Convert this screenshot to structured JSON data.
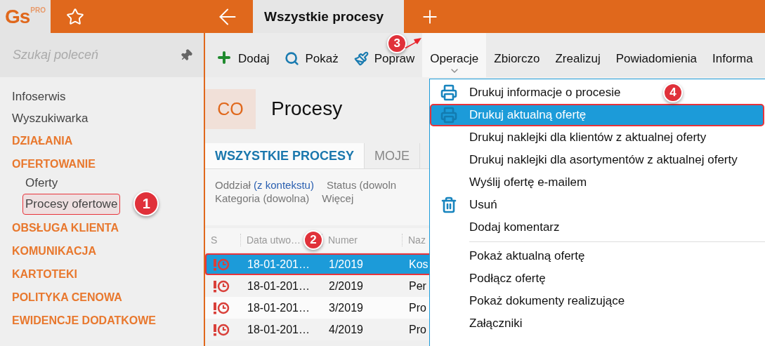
{
  "logo": {
    "text": "Gs",
    "badge": "PRO"
  },
  "tab": {
    "label": "Wszystkie procesy"
  },
  "sidebar": {
    "search": {
      "placeholder": "Szukaj poleceń"
    },
    "items": [
      {
        "kind": "link",
        "label": "Infoserwis"
      },
      {
        "kind": "link",
        "label": "Wyszukiwarka"
      },
      {
        "kind": "category",
        "label": "DZIAŁANIA"
      },
      {
        "kind": "category",
        "label": "OFERTOWANIE",
        "children": [
          {
            "label": "Oferty",
            "selected": false
          },
          {
            "label": "Procesy ofertowe",
            "selected": true,
            "badge": "1"
          }
        ]
      },
      {
        "kind": "category",
        "label": "OBSŁUGA KLIENTA"
      },
      {
        "kind": "category",
        "label": "KOMUNIKACJA"
      },
      {
        "kind": "category",
        "label": "KARTOTEKI"
      },
      {
        "kind": "category",
        "label": "POLITYKA CENOWA"
      },
      {
        "kind": "category",
        "label": "EWIDENCJE DODATKOWE"
      }
    ]
  },
  "toolbar": [
    {
      "kind": "add",
      "label": "Dodaj",
      "open": false
    },
    {
      "kind": "show",
      "label": "Pokaż",
      "open": false
    },
    {
      "kind": "edit",
      "label": "Popraw",
      "open": false,
      "badge": "3"
    },
    {
      "kind": "menu",
      "label": "Operacje",
      "open": true
    },
    {
      "kind": "menu",
      "label": "Zbiorczo",
      "open": false
    },
    {
      "kind": "menu",
      "label": "Zrealizuj",
      "open": false
    },
    {
      "kind": "menu",
      "label": "Powiadomienia",
      "open": false
    },
    {
      "kind": "menu",
      "label": "Informa",
      "open": false
    }
  ],
  "header": {
    "code": "CO",
    "title": "Procesy"
  },
  "view_tabs": [
    {
      "label": "WSZYSTKIE PROCESY",
      "selected": true
    },
    {
      "label": "MOJE",
      "selected": false
    }
  ],
  "filters": [
    [
      {
        "label": "Oddział",
        "value": "(z kontekstu)"
      },
      {
        "label": "Status (dowoln"
      }
    ],
    [
      {
        "label": "Kategoria (dowolna)"
      },
      {
        "label": "Więcej"
      }
    ]
  ],
  "table": {
    "columns": [
      {
        "label": "S"
      },
      {
        "label": "Data utwo…",
        "badge": "2"
      },
      {
        "label": "Numer"
      },
      {
        "label": "Naz"
      }
    ],
    "rows": [
      {
        "selected": true,
        "cells": [
          "",
          "18-01-201…",
          "1/2019",
          "Kos"
        ]
      },
      {
        "selected": false,
        "cells": [
          "",
          "18-01-201…",
          "2/2019",
          "Per"
        ]
      },
      {
        "selected": false,
        "cells": [
          "",
          "18-01-201…",
          "3/2019",
          "Pro"
        ]
      },
      {
        "selected": false,
        "cells": [
          "",
          "18-01-201…",
          "4/2019",
          "Pro"
        ]
      }
    ]
  },
  "menu": {
    "groups": [
      [
        {
          "kind": "print",
          "label": "Drukuj informacje o procesie",
          "selected": false,
          "badge": "4"
        },
        {
          "kind": "print",
          "label": "Drukuj aktualną ofertę",
          "selected": true
        },
        {
          "kind": "plain",
          "label": "Drukuj naklejki dla klientów z aktualnej oferty",
          "selected": false
        },
        {
          "kind": "plain",
          "label": "Drukuj naklejki dla asortymentów z aktualnej oferty",
          "selected": false
        },
        {
          "kind": "plain",
          "label": "Wyślij ofertę e-mailem",
          "selected": false
        },
        {
          "kind": "delete",
          "label": "Usuń",
          "selected": false
        },
        {
          "kind": "plain",
          "label": "Dodaj komentarz",
          "selected": false
        }
      ],
      [
        {
          "kind": "plain",
          "label": "Pokaż aktualną ofertę",
          "selected": false
        },
        {
          "kind": "plain",
          "label": "Podłącz ofertę",
          "selected": false
        },
        {
          "kind": "plain",
          "label": "Pokaż dokumenty realizujące",
          "selected": false
        },
        {
          "kind": "plain",
          "label": "Załączniki",
          "selected": false
        }
      ]
    ]
  }
}
